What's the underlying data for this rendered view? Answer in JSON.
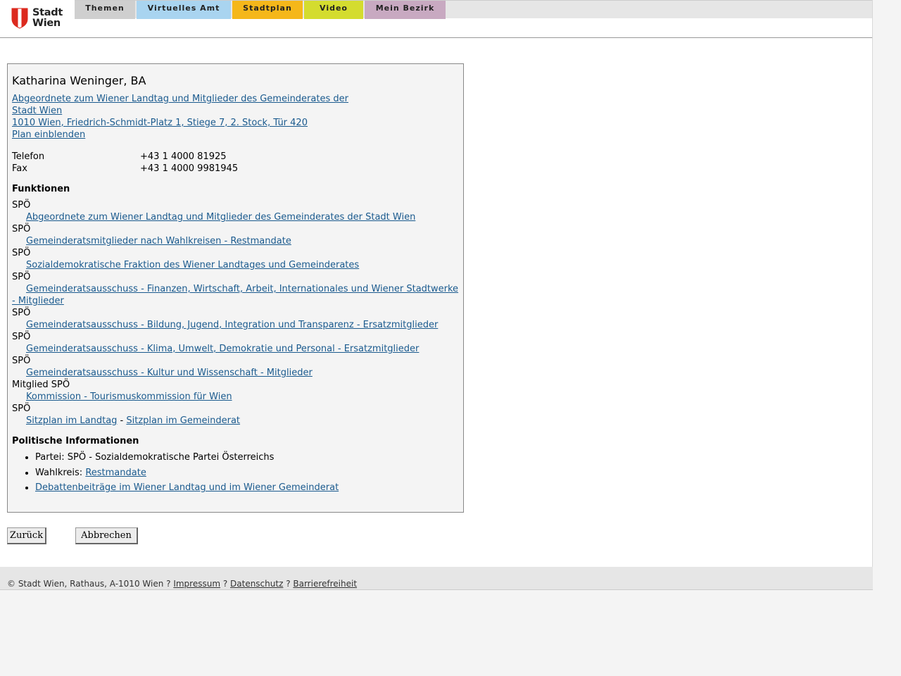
{
  "brand": {
    "line1": "Stadt",
    "line2": "Wien",
    "accent": "#dc2a1f"
  },
  "nav": {
    "tabs": [
      {
        "label": "Themen",
        "color": "#cfcfcf"
      },
      {
        "label": "Virtuelles Amt",
        "color": "#a9d4f0"
      },
      {
        "label": "Stadtplan",
        "color": "#f5b71a"
      },
      {
        "label": "Video",
        "color": "#d4dc2f"
      },
      {
        "label": "Mein Bezirk",
        "color": "#c8a9c1"
      }
    ]
  },
  "person": {
    "name": "Katharina Weninger, BA",
    "org_line1": "Abgeordnete zum Wiener Landtag und Mitglieder des Gemeinderates der",
    "org_line2": "Stadt Wien ",
    "address": "1010 Wien, Friedrich-Schmidt-Platz 1, Stiege 7, 2. Stock, Tür 420",
    "plan_link": "Plan einblenden",
    "phone_label": "Telefon",
    "phone": "+43 1 4000 81925",
    "fax_label": "Fax",
    "fax": "+43 1 4000 9981945"
  },
  "functions": {
    "title": "Funktionen",
    "items": [
      {
        "role": "SPÖ",
        "link": "Abgeordnete zum Wiener Landtag und Mitglieder des Gemeinderates der Stadt Wien"
      },
      {
        "role": "SPÖ",
        "link": "Gemeinderatsmitglieder nach Wahlkreisen - Restmandate"
      },
      {
        "role": "SPÖ",
        "link": "Sozialdemokratische Fraktion des Wiener Landtages und Gemeinderates"
      },
      {
        "role": "SPÖ",
        "link": "Gemeinderatsausschuss - Finanzen, Wirtschaft, Arbeit, Internationales und Wiener Stadtwerke - Mitglieder"
      },
      {
        "role": "SPÖ",
        "link": "Gemeinderatsausschuss - Bildung, Jugend, Integration und Transparenz - Ersatzmitglieder"
      },
      {
        "role": "SPÖ",
        "link": "Gemeinderatsausschuss - Klima, Umwelt, Demokratie und Personal - Ersatzmitglieder"
      },
      {
        "role": "SPÖ",
        "link": "Gemeinderatsausschuss - Kultur und Wissenschaft - Mitglieder"
      },
      {
        "role": "Mitglied SPÖ",
        "link": "Kommission - Tourismuskommission für Wien"
      }
    ],
    "seating": {
      "role": "SPÖ",
      "link1": "Sitzplan im Landtag",
      "sep": " - ",
      "link2": "Sitzplan im Gemeinderat"
    }
  },
  "political": {
    "title": "Politische Informationen",
    "party_text": "Partei: SPÖ - Sozialdemokratische Partei Österreichs",
    "district_label": "Wahlkreis: ",
    "district_link": "Restmandate",
    "debates_link": "Debattenbeiträge im Wiener Landtag und im Wiener Gemeinderat"
  },
  "buttons": {
    "back": "Zurück",
    "cancel": "Abbrechen"
  },
  "footer": {
    "copyright": "© Stadt Wien, Rathaus, A-1010 Wien ? ",
    "impressum": "Impressum",
    "sep1": " ? ",
    "datenschutz": "Datenschutz",
    "sep2": " ? ",
    "barrierefreiheit": "Barrierefreiheit"
  }
}
